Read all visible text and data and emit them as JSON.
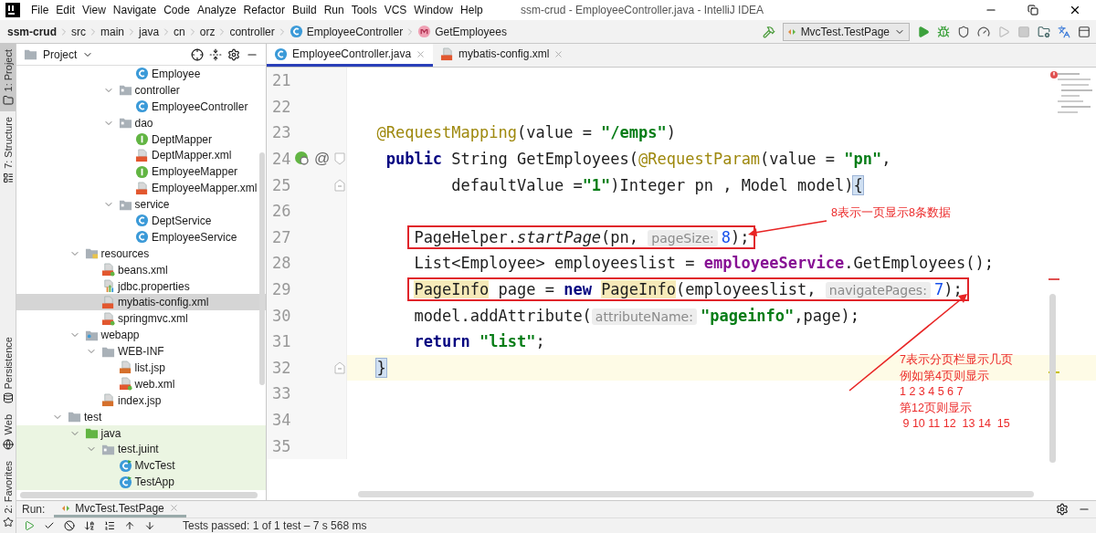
{
  "window": {
    "title": "ssm-crud - EmployeeController.java - IntelliJ IDEA"
  },
  "menu": [
    "File",
    "Edit",
    "View",
    "Navigate",
    "Code",
    "Analyze",
    "Refactor",
    "Build",
    "Run",
    "Tools",
    "VCS",
    "Window",
    "Help"
  ],
  "breadcrumbs": [
    {
      "label": "ssm-crud",
      "kind": "project"
    },
    {
      "label": "src",
      "kind": "dir"
    },
    {
      "label": "main",
      "kind": "dir"
    },
    {
      "label": "java",
      "kind": "dir"
    },
    {
      "label": "cn",
      "kind": "dir"
    },
    {
      "label": "orz",
      "kind": "dir"
    },
    {
      "label": "controller",
      "kind": "dir"
    },
    {
      "label": "EmployeeController",
      "kind": "class"
    },
    {
      "label": "GetEmployees",
      "kind": "method"
    }
  ],
  "run_config": {
    "label": "MvcTest.TestPage"
  },
  "tool_stripe_top": [
    {
      "label": "1: Project",
      "kind": "project",
      "selected": true
    },
    {
      "label": "7: Structure",
      "kind": "structure",
      "selected": false
    }
  ],
  "tool_stripe_bottom": [
    {
      "label": "Persistence",
      "kind": "persistence",
      "selected": false
    },
    {
      "label": "Web",
      "kind": "web",
      "selected": false
    },
    {
      "label": "2: Favorites",
      "kind": "favorites",
      "selected": false
    }
  ],
  "project_panel": {
    "title": "Project",
    "tree": [
      {
        "children": [
          {
            "children": [
              {
                "children": [
                  {
                    "children": [
                      {
                        "label": "Employee",
                        "kind": "class",
                        "selected": false,
                        "test_scope": false
                      }
                    ]
                  },
                  {
                    "label": "controller",
                    "kind": "package",
                    "expanded": true,
                    "selected": false,
                    "test_scope": false,
                    "children": [
                      {
                        "label": "EmployeeController",
                        "kind": "class",
                        "selected": false,
                        "test_scope": false
                      }
                    ]
                  },
                  {
                    "label": "dao",
                    "kind": "package",
                    "expanded": true,
                    "selected": false,
                    "test_scope": false,
                    "children": [
                      {
                        "label": "DeptMapper",
                        "kind": "interface",
                        "selected": false,
                        "test_scope": false
                      },
                      {
                        "label": "DeptMapper.xml",
                        "kind": "xml",
                        "selected": false,
                        "test_scope": false
                      },
                      {
                        "label": "EmployeeMapper",
                        "kind": "interface",
                        "selected": false,
                        "test_scope": false
                      },
                      {
                        "label": "EmployeeMapper.xml",
                        "kind": "xml",
                        "selected": false,
                        "test_scope": false
                      }
                    ]
                  },
                  {
                    "label": "service",
                    "kind": "package",
                    "expanded": true,
                    "selected": false,
                    "test_scope": false,
                    "children": [
                      {
                        "label": "DeptService",
                        "kind": "class",
                        "selected": false,
                        "test_scope": false
                      },
                      {
                        "label": "EmployeeService",
                        "kind": "class",
                        "selected": false,
                        "test_scope": false
                      }
                    ]
                  }
                ]
              }
            ]
          },
          {
            "label": "resources",
            "kind": "resources",
            "expanded": true,
            "selected": false,
            "test_scope": false,
            "children": [
              {
                "label": "beans.xml",
                "kind": "spring-xml",
                "selected": false,
                "test_scope": false
              },
              {
                "label": "jdbc.properties",
                "kind": "properties",
                "selected": false,
                "test_scope": false
              },
              {
                "label": "mybatis-config.xml",
                "kind": "xml",
                "selected": true,
                "test_scope": false
              },
              {
                "label": "springmvc.xml",
                "kind": "spring-xml",
                "selected": false,
                "test_scope": false
              }
            ]
          },
          {
            "label": "webapp",
            "kind": "web-folder",
            "expanded": true,
            "selected": false,
            "test_scope": false,
            "children": [
              {
                "label": "WEB-INF",
                "kind": "folder",
                "expanded": true,
                "selected": false,
                "test_scope": false,
                "children": [
                  {
                    "label": "list.jsp",
                    "kind": "jsp",
                    "selected": false,
                    "test_scope": false
                  },
                  {
                    "label": "web.xml",
                    "kind": "spring-xml",
                    "selected": false,
                    "test_scope": false
                  }
                ]
              },
              {
                "label": "index.jsp",
                "kind": "jsp",
                "selected": false,
                "test_scope": false
              }
            ]
          }
        ]
      },
      {
        "label": "test",
        "kind": "folder",
        "expanded": true,
        "selected": false,
        "test_scope": false,
        "children": [
          {
            "label": "java",
            "kind": "test-root",
            "expanded": true,
            "selected": false,
            "test_scope": true,
            "children": [
              {
                "label": "test.juint",
                "kind": "package",
                "expanded": true,
                "selected": false,
                "test_scope": true,
                "children": [
                  {
                    "label": "MvcTest",
                    "kind": "test-class",
                    "selected": false,
                    "test_scope": true
                  },
                  {
                    "label": "TestApp",
                    "kind": "test-class",
                    "selected": false,
                    "test_scope": true
                  }
                ]
              }
            ]
          }
        ]
      }
    ]
  },
  "editor": {
    "tabs": [
      {
        "label": "EmployeeController.java",
        "kind": "class",
        "selected": true
      },
      {
        "label": "mybatis-config.xml",
        "kind": "xml",
        "selected": false
      }
    ],
    "lines": [
      {
        "number": "21",
        "current": false,
        "boxed": false
      },
      {
        "number": "22",
        "current": false,
        "boxed": false
      },
      {
        "number": "23",
        "current": false,
        "boxed": false,
        "kind": "member",
        "tokens": [
          {
            "text": "@RequestMapping",
            "kind": "annotation"
          },
          {
            "text": "(value = ",
            "kind": "plain"
          },
          {
            "text": "\"/emps\"",
            "kind": "string"
          },
          {
            "text": ")",
            "kind": "plain"
          }
        ]
      },
      {
        "number": "24",
        "current": false,
        "boxed": false,
        "kind": "signature",
        "gutter": [
          {
            "kind": "bean"
          },
          {
            "kind": "symbol",
            "text": "@"
          },
          {
            "kind": "fold-start"
          }
        ],
        "tokens": [
          {
            "text": "public",
            "kind": "keyword"
          },
          {
            "text": " String GetEmployees(",
            "kind": "plain"
          },
          {
            "text": "@RequestParam",
            "kind": "annotation"
          },
          {
            "text": "(value = ",
            "kind": "plain"
          },
          {
            "text": "\"pn\"",
            "kind": "string"
          },
          {
            "text": ",",
            "kind": "plain"
          }
        ]
      },
      {
        "number": "25",
        "current": false,
        "boxed": false,
        "kind": "continuation",
        "gutter": [
          {
            "kind": "fold-end"
          }
        ],
        "tokens": [
          {
            "text": "defaultValue =",
            "kind": "plain"
          },
          {
            "text": "\"1\"",
            "kind": "string"
          },
          {
            "text": ")Integer pn , Model model)",
            "kind": "plain"
          },
          {
            "text": "{",
            "kind": "brace-match"
          }
        ]
      },
      {
        "number": "26",
        "current": false,
        "boxed": false
      },
      {
        "number": "27",
        "current": false,
        "boxed": true,
        "kind": "body",
        "tokens": [
          {
            "text": "PageHelper.",
            "kind": "plain"
          },
          {
            "text": "startPage",
            "kind": "static-method"
          },
          {
            "text": "(pn, ",
            "kind": "plain"
          },
          {
            "text": "pageSize:",
            "kind": "hint"
          },
          {
            "text": "8",
            "kind": "number"
          },
          {
            "text": ");",
            "kind": "plain"
          }
        ]
      },
      {
        "number": "28",
        "current": false,
        "boxed": false,
        "kind": "body",
        "tokens": [
          {
            "text": "List<Employee> employeeslist = ",
            "kind": "plain"
          },
          {
            "text": "employeeService",
            "kind": "field"
          },
          {
            "text": ".GetEmployees();",
            "kind": "plain"
          }
        ]
      },
      {
        "number": "29",
        "current": false,
        "boxed": true,
        "kind": "body",
        "tokens": [
          {
            "text": "PageInfo",
            "kind": "usage"
          },
          {
            "text": " page = ",
            "kind": "plain"
          },
          {
            "text": "new ",
            "kind": "keyword"
          },
          {
            "text": "PageInfo",
            "kind": "usage"
          },
          {
            "text": "(employeeslist, ",
            "kind": "plain"
          },
          {
            "text": "navigatePages:",
            "kind": "hint"
          },
          {
            "text": "7",
            "kind": "number"
          },
          {
            "text": ");",
            "kind": "plain"
          }
        ]
      },
      {
        "number": "30",
        "current": false,
        "boxed": false,
        "kind": "body",
        "tokens": [
          {
            "text": "model.addAttribute(",
            "kind": "plain"
          },
          {
            "text": "attributeName:",
            "kind": "hint"
          },
          {
            "text": "\"pageinfo\"",
            "kind": "string"
          },
          {
            "text": ",page);",
            "kind": "plain"
          }
        ]
      },
      {
        "number": "31",
        "current": false,
        "boxed": false,
        "kind": "body",
        "tokens": [
          {
            "text": "return ",
            "kind": "keyword"
          },
          {
            "text": "\"list\"",
            "kind": "string"
          },
          {
            "text": ";",
            "kind": "plain"
          }
        ]
      },
      {
        "number": "32",
        "current": true,
        "boxed": false,
        "kind": "member",
        "gutter": [
          {
            "kind": "fold-end"
          }
        ],
        "tokens": [
          {
            "text": "}",
            "kind": "brace-match"
          }
        ]
      },
      {
        "number": "33",
        "current": false,
        "boxed": false
      },
      {
        "number": "34",
        "current": false,
        "boxed": false
      },
      {
        "number": "35",
        "current": false,
        "boxed": false
      }
    ],
    "notes": [
      {
        "lines": [
          "8表示一页显示8条数据"
        ]
      },
      {
        "lines": [
          "7表示分页栏显示几页",
          "例如第4页则显示",
          "1 2 3 4 5 6 7",
          "第12页则显示",
          " 9 10 11 12  13 14  15"
        ]
      }
    ]
  },
  "run_panel": {
    "label": "Run:",
    "tabs": [
      {
        "label": "MvcTest.TestPage",
        "selected": true
      }
    ],
    "status": "Tests passed: 1 of 1 test – 7 s 568 ms"
  }
}
